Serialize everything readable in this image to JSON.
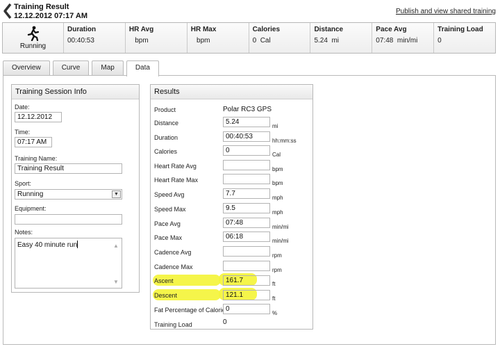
{
  "header": {
    "title": "Training Result",
    "datetime": "12.12.2012 07:17 AM",
    "share_link": "Publish and view shared training"
  },
  "summary": {
    "sport": "Running",
    "cells": [
      {
        "label": "Duration",
        "value": "00:40:53"
      },
      {
        "label": "HR Avg",
        "value": "   bpm"
      },
      {
        "label": "HR Max",
        "value": "   bpm"
      },
      {
        "label": "Calories",
        "value": "0  Cal"
      },
      {
        "label": "Distance",
        "value": "5.24  mi"
      },
      {
        "label": "Pace Avg",
        "value": "07:48  min/mi"
      },
      {
        "label": "Training Load",
        "value": "0"
      }
    ]
  },
  "tabs": [
    "Overview",
    "Curve",
    "Map",
    "Data"
  ],
  "active_tab": "Data",
  "session": {
    "title": "Training Session Info",
    "date_label": "Date:",
    "date_value": "12.12.2012",
    "time_label": "Time:",
    "time_value": "07:17 AM",
    "name_label": "Training Name:",
    "name_value": "Training Result",
    "sport_label": "Sport:",
    "sport_value": "Running",
    "equipment_label": "Equipment:",
    "equipment_value": "",
    "notes_label": "Notes:",
    "notes_value": "Easy 40 minute run"
  },
  "results": {
    "title": "Results",
    "product_label": "Product",
    "product_value": "Polar RC3 GPS",
    "rows": [
      {
        "label": "Distance",
        "value": "5.24",
        "unit": "mi"
      },
      {
        "label": "Duration",
        "value": "00:40:53",
        "unit": "hh:mm:ss"
      },
      {
        "label": "Calories",
        "value": "0",
        "unit": "Cal"
      },
      {
        "label": "Heart Rate Avg",
        "value": "",
        "unit": "bpm"
      },
      {
        "label": "Heart Rate Max",
        "value": "",
        "unit": "bpm"
      },
      {
        "label": "Speed Avg",
        "value": "7.7",
        "unit": "mph"
      },
      {
        "label": "Speed Max",
        "value": "9.5",
        "unit": "mph"
      },
      {
        "label": "Pace Avg",
        "value": "07:48",
        "unit": "min/mi"
      },
      {
        "label": "Pace Max",
        "value": "06:18",
        "unit": "min/mi"
      },
      {
        "label": "Cadence Avg",
        "value": "",
        "unit": "rpm"
      },
      {
        "label": "Cadence Max",
        "value": "",
        "unit": "rpm"
      },
      {
        "label": "Ascent",
        "value": "161.7",
        "unit": "ft"
      },
      {
        "label": "Descent",
        "value": "121.1",
        "unit": "ft"
      },
      {
        "label": "Fat Percentage of Calories",
        "value": "0",
        "unit": "%"
      }
    ],
    "training_load_label": "Training Load",
    "training_load_value": "0"
  },
  "colors": {
    "highlight": "#f4f43b",
    "border": "#b7b7b7"
  },
  "icons": {
    "back": "chevron-left-icon",
    "sport": "runner-icon"
  }
}
